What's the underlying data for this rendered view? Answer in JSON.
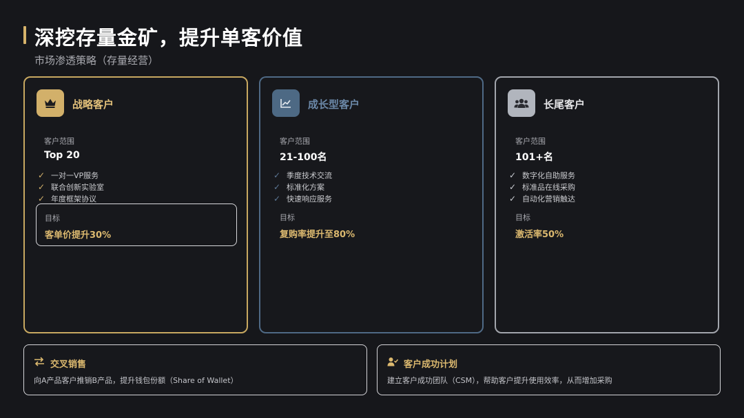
{
  "header": {
    "title": "深挖存量金矿，提升单客价值",
    "subtitle": "市场渗透策略（存量经营）"
  },
  "cards": [
    {
      "title": "战略客户",
      "icon": "crown-icon",
      "range_label": "客户范围",
      "range_value": "Top 20",
      "features": [
        "一对一VP服务",
        "联合创新实验室",
        "年度框架协议"
      ],
      "goal_label": "目标",
      "goal_value": "客单价提升30%"
    },
    {
      "title": "成长型客户",
      "icon": "chart-line-icon",
      "range_label": "客户范围",
      "range_value": "21-100名",
      "features": [
        "季度技术交流",
        "标准化方案",
        "快速响应服务"
      ],
      "goal_label": "目标",
      "goal_value": "复购率提升至80%"
    },
    {
      "title": "长尾客户",
      "icon": "users-icon",
      "range_label": "客户范围",
      "range_value": "101+名",
      "features": [
        "数字化自助服务",
        "标准品在线采购",
        "自动化营销触达"
      ],
      "goal_label": "目标",
      "goal_value": "激活率50%"
    }
  ],
  "bottom": [
    {
      "title": "交叉销售",
      "icon": "exchange-icon",
      "description": "向A产品客户推销B产品，提升钱包份额（Share of Wallet）"
    },
    {
      "title": "客户成功计划",
      "icon": "user-check-icon",
      "description": "建立客户成功团队（CSM），帮助客户提升使用效率，从而增加采购"
    }
  ],
  "colors": {
    "accent_gold": "#d2b06a",
    "accent_blue": "#4d6984",
    "accent_gray": "#b1b5bd",
    "background": "#16171b"
  }
}
